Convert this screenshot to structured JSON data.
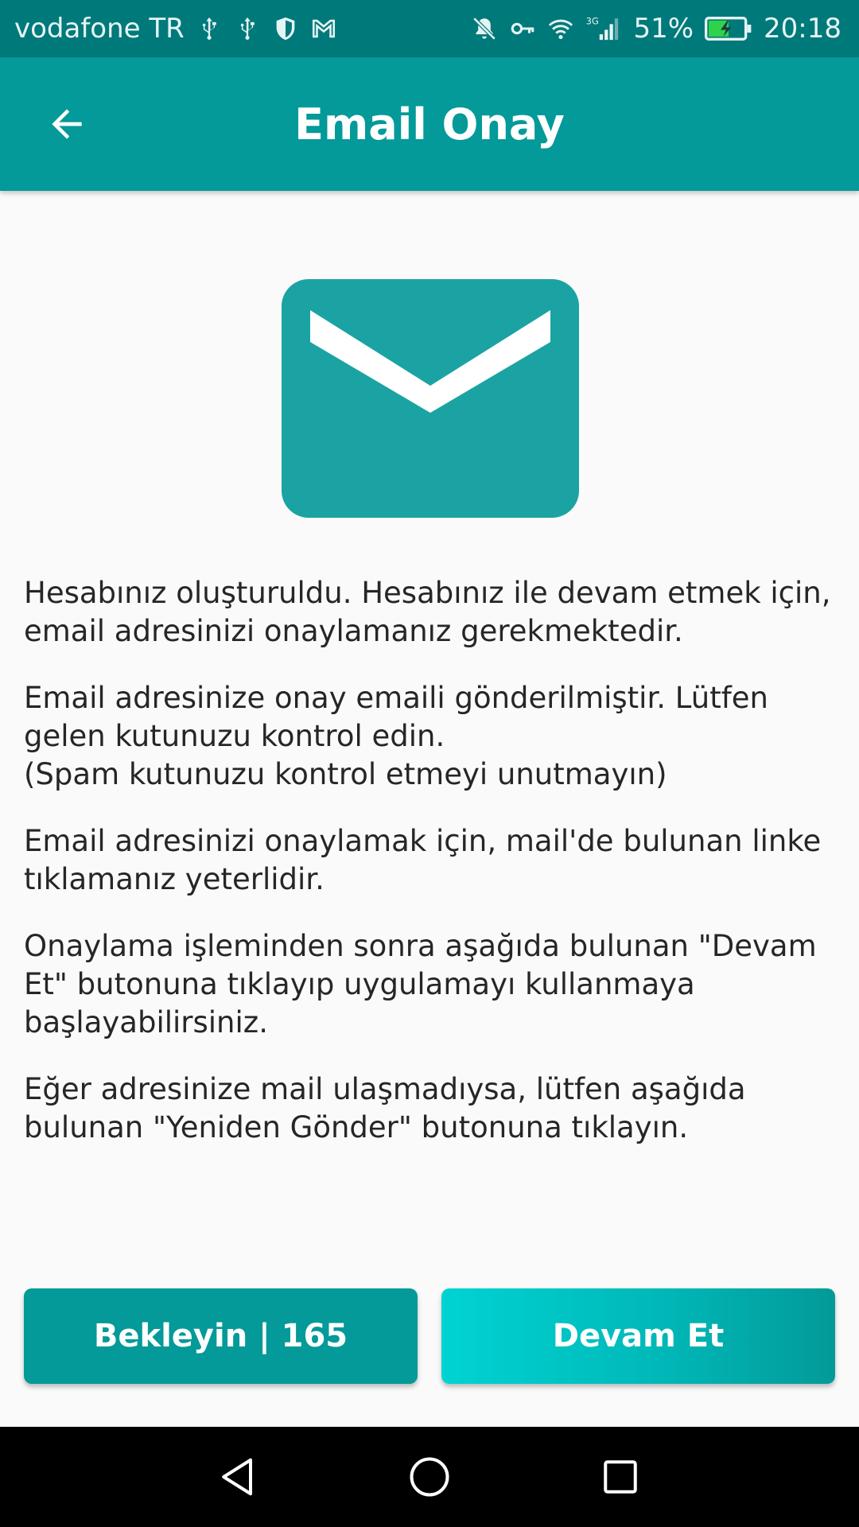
{
  "status_bar": {
    "carrier": "vodafone TR",
    "network_type": "3G",
    "battery_percent": "51%",
    "time": "20:18",
    "icons_left": [
      "usb-icon",
      "usb-icon",
      "shield-icon",
      "gmail-icon"
    ],
    "icons_right": [
      "mute-icon",
      "vpn-key-icon",
      "wifi-icon",
      "signal-icon",
      "battery-charging-icon"
    ]
  },
  "app_bar": {
    "title": "Email Onay",
    "back_icon": "arrow-back-icon"
  },
  "illustration": {
    "icon": "envelope-icon",
    "color": "#1ba3a3"
  },
  "paragraphs": [
    {
      "lines": [
        "Hesabınız oluşturuldu. Hesabınız ile devam etmek için,",
        "email adresinizi onaylamanız gerekmektedir."
      ]
    },
    {
      "lines": [
        "Email adresinize onay emaili gönderilmiştir. Lütfen",
        "gelen kutunuzu kontrol edin.",
        "(Spam kutunuzu kontrol etmeyi unutmayın)"
      ]
    },
    {
      "lines": [
        "Email adresinizi onaylamak için, mail'de bulunan linke",
        "tıklamanız yeterlidir."
      ]
    },
    {
      "lines": [
        "Onaylama işleminden sonra aşağıda bulunan \"Devam",
        "Et\" butonuna tıklayıp uygulamayı kullanmaya",
        "başlayabilirsiniz."
      ]
    },
    {
      "lines": [
        "Eğer adresinize mail ulaşmadıysa, lütfen aşağıda",
        "bulunan \"Yeniden Gönder\" butonuna tıklayın."
      ]
    }
  ],
  "buttons": {
    "wait_label": "Bekleyin | 165",
    "continue_label": "Devam Et"
  },
  "nav_bar": {
    "icons": [
      "back-triangle-icon",
      "home-circle-icon",
      "recents-square-icon"
    ]
  },
  "colors": {
    "status_bar": "#00797a",
    "app_bar": "#039a99",
    "primary_button": "#039a99",
    "accent_button": "#00d3d3",
    "background": "#fafafa"
  }
}
